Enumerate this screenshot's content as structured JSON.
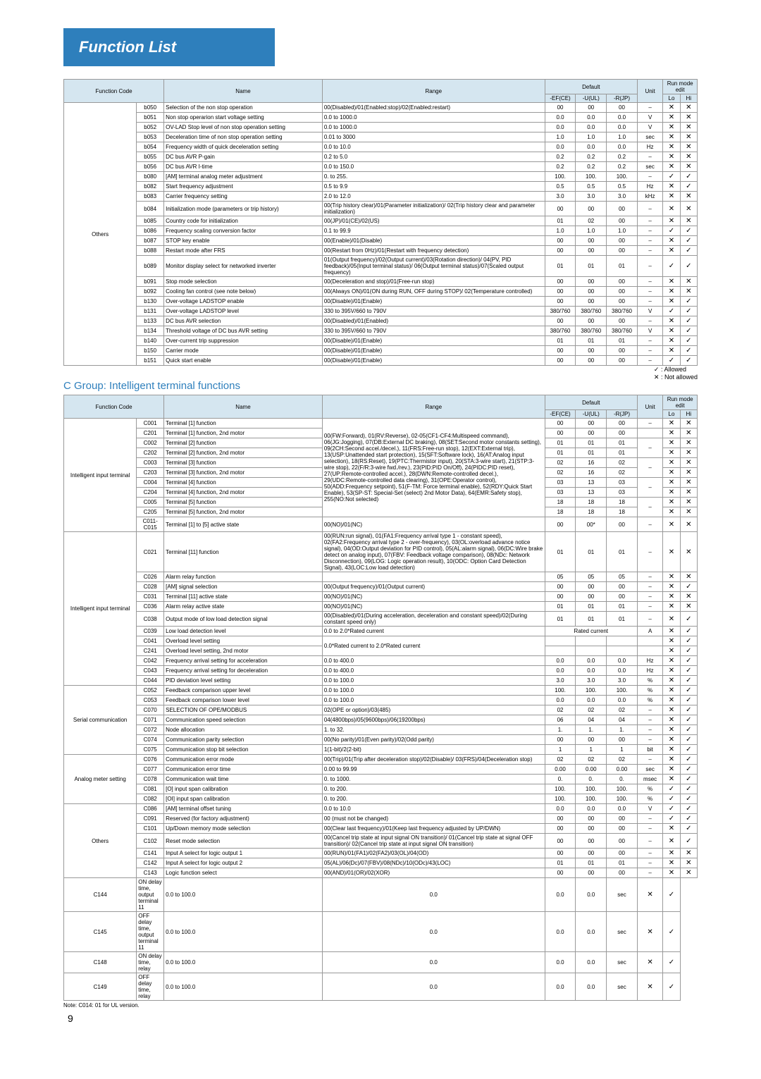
{
  "page": {
    "title": "Function List",
    "groupB_name": "Others",
    "groupC_title": "C Group: Intelligent terminal functions",
    "legend_allowed": "✓ : Allowed",
    "legend_notallowed": "✕ : Not allowed",
    "footnote": "Note: C014: 01 for UL version.",
    "pagenum": "9"
  },
  "headers": {
    "function_code": "Function Code",
    "name": "Name",
    "range": "Range",
    "default": "Default",
    "d1": "-EF(CE)",
    "d2": "-U(UL)",
    "d3": "-R(JP)",
    "unit": "Unit",
    "runmode": "Run mode edit",
    "lo": "Lo",
    "hi": "Hi"
  },
  "b_rows": [
    {
      "code": "b050",
      "name": "Selection of the non stop operation",
      "range": "00(Disabled)/01(Enabled:stop)/02(Enabled:restart)",
      "d1": "00",
      "d2": "00",
      "d3": "00",
      "unit": "–",
      "lo": "✕",
      "hi": "✕"
    },
    {
      "code": "b051",
      "name": "Non stop operarion start voltage setting",
      "range": "0.0 to 1000.0",
      "d1": "0.0",
      "d2": "0.0",
      "d3": "0.0",
      "unit": "V",
      "lo": "✕",
      "hi": "✕"
    },
    {
      "code": "b052",
      "name": "OV-LAD Stop level of non stop operation setting",
      "range": "0.0 to 1000.0",
      "d1": "0.0",
      "d2": "0.0",
      "d3": "0.0",
      "unit": "V",
      "lo": "✕",
      "hi": "✕"
    },
    {
      "code": "b053",
      "name": "Deceleration time of non stop operation setting",
      "range": "0.01 to 3000",
      "d1": "1.0",
      "d2": "1.0",
      "d3": "1.0",
      "unit": "sec",
      "lo": "✕",
      "hi": "✕"
    },
    {
      "code": "b054",
      "name": "Frequency width of quick deceleration setting",
      "range": "0.0 to 10.0",
      "d1": "0.0",
      "d2": "0.0",
      "d3": "0.0",
      "unit": "Hz",
      "lo": "✕",
      "hi": "✕"
    },
    {
      "code": "b055",
      "name": "DC bus AVR P-gain",
      "range": "0.2 to 5.0",
      "d1": "0.2",
      "d2": "0.2",
      "d3": "0.2",
      "unit": "–",
      "lo": "✕",
      "hi": "✕"
    },
    {
      "code": "b056",
      "name": "DC bus AVR I-time",
      "range": "0.0 to 150.0",
      "d1": "0.2",
      "d2": "0.2",
      "d3": "0.2",
      "unit": "sec",
      "lo": "✕",
      "hi": "✕"
    },
    {
      "code": "b080",
      "name": "[AM] terminal analog meter adjustment",
      "range": "0. to 255.",
      "d1": "100.",
      "d2": "100.",
      "d3": "100.",
      "unit": "–",
      "lo": "✓",
      "hi": "✓"
    },
    {
      "code": "b082",
      "name": "Start frequency adjustment",
      "range": "0.5 to 9.9",
      "d1": "0.5",
      "d2": "0.5",
      "d3": "0.5",
      "unit": "Hz",
      "lo": "✕",
      "hi": "✓"
    },
    {
      "code": "b083",
      "name": "Carrier frequency setting",
      "range": "2.0 to 12.0",
      "d1": "3.0",
      "d2": "3.0",
      "d3": "3.0",
      "unit": "kHz",
      "lo": "✕",
      "hi": "✕"
    },
    {
      "code": "b084",
      "name": "Initialization mode (parameters or trip history)",
      "range": "00(Trip history clear)/01(Parameter initialization)/ 02(Trip history clear and parameter initialization)",
      "d1": "00",
      "d2": "00",
      "d3": "00",
      "unit": "–",
      "lo": "✕",
      "hi": "✕"
    },
    {
      "code": "b085",
      "name": "Country code for initialization",
      "range": "00(JP)/01(CE)/02(US)",
      "d1": "01",
      "d2": "02",
      "d3": "00",
      "unit": "–",
      "lo": "✕",
      "hi": "✕"
    },
    {
      "code": "b086",
      "name": "Frequency scaling conversion factor",
      "range": "0.1 to 99.9",
      "d1": "1.0",
      "d2": "1.0",
      "d3": "1.0",
      "unit": "–",
      "lo": "✓",
      "hi": "✓"
    },
    {
      "code": "b087",
      "name": "STOP key enable",
      "range": "00(Enable)/01(Disable)",
      "d1": "00",
      "d2": "00",
      "d3": "00",
      "unit": "–",
      "lo": "✕",
      "hi": "✓"
    },
    {
      "code": "b088",
      "name": "Restart mode after FRS",
      "range": "00(Restart from 0Hz)/01(Restart with frequency detection)",
      "d1": "00",
      "d2": "00",
      "d3": "00",
      "unit": "–",
      "lo": "✕",
      "hi": "✓"
    },
    {
      "code": "b089",
      "name": "Monitor display select for networked inverter",
      "range": "01(Output frequency)/02(Output current)/03(Rotation direction)/ 04(PV, PID feedback)/05(Input terminal status)/ 06(Output terminal status)/07(Scaled output frequency)",
      "d1": "01",
      "d2": "01",
      "d3": "01",
      "unit": "–",
      "lo": "✓",
      "hi": "✓"
    },
    {
      "code": "b091",
      "name": "Stop mode selection",
      "range": "00(Deceleration and stop)/01(Free-run stop)",
      "d1": "00",
      "d2": "00",
      "d3": "00",
      "unit": "–",
      "lo": "✕",
      "hi": "✕"
    },
    {
      "code": "b092",
      "name": "Cooling fan control (see note below)",
      "range": "00(Always ON)/01(ON during RUN, OFF during STOP)/ 02(Temperature controlled)",
      "d1": "00",
      "d2": "00",
      "d3": "00",
      "unit": "–",
      "lo": "✕",
      "hi": "✕"
    },
    {
      "code": "b130",
      "name": "Over-voltage LADSTOP enable",
      "range": "00(Disable)/01(Enable)",
      "d1": "00",
      "d2": "00",
      "d3": "00",
      "unit": "–",
      "lo": "✕",
      "hi": "✓"
    },
    {
      "code": "b131",
      "name": "Over-voltage LADSTOP level",
      "range": "330 to 395V/660 to 790V",
      "d1": "380/760",
      "d2": "380/760",
      "d3": "380/760",
      "unit": "V",
      "lo": "✓",
      "hi": "✓"
    },
    {
      "code": "b133",
      "name": "DC bus AVR selection",
      "range": "00(Disabled)/01(Enabled)",
      "d1": "00",
      "d2": "00",
      "d3": "00",
      "unit": "–",
      "lo": "✕",
      "hi": "✓"
    },
    {
      "code": "b134",
      "name": "Threshold voltage of DC bus AVR setting",
      "range": "330 to 395V/660 to 790V",
      "d1": "380/760",
      "d2": "380/760",
      "d3": "380/760",
      "unit": "V",
      "lo": "✕",
      "hi": "✓"
    },
    {
      "code": "b140",
      "name": "Over-current trip suppression",
      "range": "00(Disable)/01(Enable)",
      "d1": "01",
      "d2": "01",
      "d3": "01",
      "unit": "–",
      "lo": "✕",
      "hi": "✓"
    },
    {
      "code": "b150",
      "name": "Carrier mode",
      "range": "00(Disable)/01(Enable)",
      "d1": "00",
      "d2": "00",
      "d3": "00",
      "unit": "–",
      "lo": "✕",
      "hi": "✓"
    },
    {
      "code": "b151",
      "name": "Quick start enable",
      "range": "00(Disable)/01(Enable)",
      "d1": "00",
      "d2": "00",
      "d3": "00",
      "unit": "–",
      "lo": "✓",
      "hi": "✓"
    }
  ],
  "c_groups": [
    {
      "name": "Intelligent input terminal",
      "spanstart": 0,
      "span": 11
    },
    {
      "name": "Intelligent input terminal",
      "spanstart": 11,
      "span": 12
    },
    {
      "name": "Serial communication",
      "spanstart": 23,
      "span": 7
    },
    {
      "name": "Analog meter setting",
      "spanstart": 30,
      "span": 5
    },
    {
      "name": "Others",
      "spanstart": 35,
      "span": 7
    }
  ],
  "c_rows": [
    {
      "code": "C001",
      "name": "Terminal [1] function",
      "range": "00(FW:Forward), 01(RV:Reverse), 02-05(CF1-CF4:Multispeed command), 06(JG:Jogging), 07(DB:External DC braking), 08(SET:Second motor constants setting), 09(2CH:Second accel./decel.), 11(FRS:Free-run stop), 12(EXT:External trip), 13(USP:Unattended start protection), 15(SFT:Software lock), 16(AT:Analog input selection), 18(RS:Reset), 19(PTC:Thermistor input), 20(STA:3-wire start), 21(STP:3-wire stop), 22(F/R:3-wire fwd./rev.), 23(PID:PID On/Off), 24(PIDC:PID reset), 27(UP:Remote-controlled accel.), 28(DWN:Remote-controlled decel.), 29(UDC:Remote-controlled data clearing), 31(OPE:Operator control), 50(ADD:Frequency setpoint), 51(F-TM: Force terminal enable), 52(RDY:Quick Start Enable), 53(SP-ST: Special-Set (select) 2nd Motor Data), 64(EMR:Safety stop), 255(NO:Not selected)",
      "d1": "00",
      "d2": "00",
      "d3": "00",
      "unit": "–",
      "lo": "✕",
      "hi": "✕",
      "rangerowspan": 10
    },
    {
      "code": "C201",
      "name": "Terminal [1] function, 2nd motor",
      "range": "",
      "d1": "00",
      "d2": "00",
      "d3": "00",
      "unit": "",
      "lo": "✕",
      "hi": "✕"
    },
    {
      "code": "C002",
      "name": "Terminal [2] function",
      "range": "",
      "d1": "01",
      "d2": "01",
      "d3": "01",
      "unit": "–",
      "lo": "✕",
      "hi": "✕",
      "unitspan": 2
    },
    {
      "code": "C202",
      "name": "Terminal [2] function, 2nd motor",
      "range": "",
      "d1": "01",
      "d2": "01",
      "d3": "01",
      "unit": "",
      "lo": "✕",
      "hi": "✕"
    },
    {
      "code": "C003",
      "name": "Terminal [3] function",
      "range": "",
      "d1": "02",
      "d2": "16",
      "d3": "02",
      "unit": "–",
      "lo": "✕",
      "hi": "✕",
      "unitspan": 2
    },
    {
      "code": "C203",
      "name": "Terminal [3] function, 2nd motor",
      "range": "",
      "d1": "02",
      "d2": "16",
      "d3": "02",
      "unit": "",
      "lo": "✕",
      "hi": "✕"
    },
    {
      "code": "C004",
      "name": "Terminal [4] function",
      "range": "",
      "d1": "03",
      "d2": "13",
      "d3": "03",
      "unit": "–",
      "lo": "✕",
      "hi": "✕",
      "unitspan": 2
    },
    {
      "code": "C204",
      "name": "Terminal [4] function, 2nd motor",
      "range": "",
      "d1": "03",
      "d2": "13",
      "d3": "03",
      "unit": "",
      "lo": "✕",
      "hi": "✕"
    },
    {
      "code": "C005",
      "name": "Terminal [5] function",
      "range": "",
      "d1": "18",
      "d2": "18",
      "d3": "18",
      "unit": "–",
      "lo": "✕",
      "hi": "✕",
      "unitspan": 2
    },
    {
      "code": "C205",
      "name": "Terminal [5] function, 2nd motor",
      "range": "",
      "d1": "18",
      "d2": "18",
      "d3": "18",
      "unit": "",
      "lo": "✕",
      "hi": "✕"
    },
    {
      "code": "C011-C015",
      "name": "Terminal [1] to [5] active state",
      "range": "00(NO)/01(NC)",
      "d1": "00",
      "d2": "00*",
      "d3": "00",
      "unit": "–",
      "lo": "✕",
      "hi": "✕"
    },
    {
      "code": "C021",
      "name": "Terminal [11] function",
      "range": "00(RUN:run signal), 01(FA1:Frequency arrival type 1 - constant speed), 02(FA2:Frequency arrival type 2 - over-frequency), 03(OL:overload advance notice signal), 04(OD:Output deviation for PID control), 05(AL:alarm signal), 06(DC:Wire brake detect on analog input), 07(FBV: Feedback voltage comparison), 08(NDc: Network Disconnection), 09(LOG: Logic operation result), 10(ODC: Option Card Detection Signal), 43(LOC:Low load detection)",
      "d1": "01",
      "d2": "01",
      "d3": "01",
      "unit": "–",
      "lo": "✕",
      "hi": "✕"
    },
    {
      "code": "C026",
      "name": "Alarm relay function",
      "range": "",
      "d1": "05",
      "d2": "05",
      "d3": "05",
      "unit": "–",
      "lo": "✕",
      "hi": "✕"
    },
    {
      "code": "C028",
      "name": "[AM] signal selection",
      "range": "00(Output frequency)/01(Output current)",
      "d1": "00",
      "d2": "00",
      "d3": "00",
      "unit": "–",
      "lo": "✕",
      "hi": "✓"
    },
    {
      "code": "C031",
      "name": "Terminal [11] active state",
      "range": "00(NO)/01(NC)",
      "d1": "00",
      "d2": "00",
      "d3": "00",
      "unit": "–",
      "lo": "✕",
      "hi": "✕"
    },
    {
      "code": "C036",
      "name": "Alarm relay active state",
      "range": "00(NO)/01(NC)",
      "d1": "01",
      "d2": "01",
      "d3": "01",
      "unit": "–",
      "lo": "✕",
      "hi": "✕"
    },
    {
      "code": "C038",
      "name": "Output mode of low load detection signal",
      "range": "00(Disabled)/01(During acceleration, deceleration and constant speed)/02(During constant speed only)",
      "d1": "01",
      "d2": "01",
      "d3": "01",
      "unit": "–",
      "lo": "✕",
      "hi": "✓"
    },
    {
      "code": "C039",
      "name": "Low load detection level",
      "range": "0.0 to 2.0*Rated current",
      "d1": "",
      "d2": "",
      "d3": "",
      "unit": "",
      "lo": "✕",
      "hi": "✓",
      "d_merge": "Rated current",
      "d_unit": "A"
    },
    {
      "code": "C041",
      "name": "Overload level setting",
      "range": "0.0*Rated current to 2.0*Rated current",
      "d1": "",
      "d2": "",
      "d3": "",
      "unit": "",
      "lo": "✕",
      "hi": "✓",
      "rangerowspan": 2,
      "d_merge_rows": 2
    },
    {
      "code": "C241",
      "name": "Overload level setting, 2nd motor",
      "range": "",
      "d1": "",
      "d2": "",
      "d3": "",
      "unit": "",
      "lo": "✕",
      "hi": "✓"
    },
    {
      "code": "C042",
      "name": "Frequency arrival setting for acceleration",
      "range": "0.0 to 400.0",
      "d1": "0.0",
      "d2": "0.0",
      "d3": "0.0",
      "unit": "Hz",
      "lo": "✕",
      "hi": "✓"
    },
    {
      "code": "C043",
      "name": "Frequency arrival setting for deceleration",
      "range": "0.0 to 400.0",
      "d1": "0.0",
      "d2": "0.0",
      "d3": "0.0",
      "unit": "Hz",
      "lo": "✕",
      "hi": "✓"
    },
    {
      "code": "C044",
      "name": "PID deviation level setting",
      "range": "0.0 to 100.0",
      "d1": "3.0",
      "d2": "3.0",
      "d3": "3.0",
      "unit": "%",
      "lo": "✕",
      "hi": "✓"
    },
    {
      "code": "C052",
      "name": "Feedback comparison upper level",
      "range": "0.0 to 100.0",
      "d1": "100.",
      "d2": "100.",
      "d3": "100.",
      "unit": "%",
      "lo": "✕",
      "hi": "✓"
    },
    {
      "code": "C053",
      "name": "Feedback comparison lower level",
      "range": "0.0 to 100.0",
      "d1": "0.0",
      "d2": "0.0",
      "d3": "0.0",
      "unit": "%",
      "lo": "✕",
      "hi": "✓"
    },
    {
      "code": "C070",
      "name": "SELECTION OF OPE/MODBUS",
      "range": "02(OPE or option)/03(485)",
      "d1": "02",
      "d2": "02",
      "d3": "02",
      "unit": "–",
      "lo": "✕",
      "hi": "✓"
    },
    {
      "code": "C071",
      "name": "Communication speed selection",
      "range": "04(4800bps)/05(9600bps)/06(19200bps)",
      "d1": "06",
      "d2": "04",
      "d3": "04",
      "unit": "–",
      "lo": "✕",
      "hi": "✓"
    },
    {
      "code": "C072",
      "name": "Node allocation",
      "range": "1. to 32.",
      "d1": "1.",
      "d2": "1.",
      "d3": "1.",
      "unit": "–",
      "lo": "✕",
      "hi": "✓"
    },
    {
      "code": "C074",
      "name": "Communication parity selection",
      "range": "00(No parity)/01(Even parity)/02(Odd parity)",
      "d1": "00",
      "d2": "00",
      "d3": "00",
      "unit": "–",
      "lo": "✕",
      "hi": "✓"
    },
    {
      "code": "C075",
      "name": "Communication stop bit selection",
      "range": "1(1-bit)/2(2-bit)",
      "d1": "1",
      "d2": "1",
      "d3": "1",
      "unit": "bit",
      "lo": "✕",
      "hi": "✓"
    },
    {
      "code": "C076",
      "name": "Communication error mode",
      "range": "00(Trip)/01(Trip after deceleration stop)/02(Disable)/ 03(FRS)/04(Deceleration stop)",
      "d1": "02",
      "d2": "02",
      "d3": "02",
      "unit": "–",
      "lo": "✕",
      "hi": "✓"
    },
    {
      "code": "C077",
      "name": "Communication error time",
      "range": "0.00 to 99.99",
      "d1": "0.00",
      "d2": "0.00",
      "d3": "0.00",
      "unit": "sec",
      "lo": "✕",
      "hi": "✓"
    },
    {
      "code": "C078",
      "name": "Communication wait time",
      "range": "0. to 1000.",
      "d1": "0.",
      "d2": "0.",
      "d3": "0.",
      "unit": "msec",
      "lo": "✕",
      "hi": "✓"
    },
    {
      "code": "C081",
      "name": "[O] input span calibration",
      "range": "0. to 200.",
      "d1": "100.",
      "d2": "100.",
      "d3": "100.",
      "unit": "%",
      "lo": "✓",
      "hi": "✓"
    },
    {
      "code": "C082",
      "name": "[OI] input span calibration",
      "range": "0. to 200.",
      "d1": "100.",
      "d2": "100.",
      "d3": "100.",
      "unit": "%",
      "lo": "✓",
      "hi": "✓"
    },
    {
      "code": "C086",
      "name": "[AM] terminal offset tuning",
      "range": "0.0 to 10.0",
      "d1": "0.0",
      "d2": "0.0",
      "d3": "0.0",
      "unit": "V",
      "lo": "✓",
      "hi": "✓"
    },
    {
      "code": "C091",
      "name": "Reserved (for factory adjustment)",
      "range": "00 (must not be changed)",
      "d1": "00",
      "d2": "00",
      "d3": "00",
      "unit": "–",
      "lo": "✓",
      "hi": "✓"
    },
    {
      "code": "C101",
      "name": "Up/Down memory mode selection",
      "range": "00(Clear last frequency)/01(Keep last frequency adjusted by UP/DWN)",
      "d1": "00",
      "d2": "00",
      "d3": "00",
      "unit": "–",
      "lo": "✕",
      "hi": "✓"
    },
    {
      "code": "C102",
      "name": "Reset mode selection",
      "range": "00(Cancel trip state at input signal ON transition)/ 01(Cancel trip state at signal OFF transition)/ 02(Cancel trip state at input signal ON transition)",
      "d1": "00",
      "d2": "00",
      "d3": "00",
      "unit": "–",
      "lo": "✕",
      "hi": "✓"
    },
    {
      "code": "C141",
      "name": "Input A select for logic output 1",
      "range": "00(RUN)/01(FA1)/02(FA2)/03(OL)/04(OD)",
      "d1": "00",
      "d2": "00",
      "d3": "00",
      "unit": "–",
      "lo": "✕",
      "hi": "✕"
    },
    {
      "code": "C142",
      "name": "Input A select for logic output 2",
      "range": "05(AL)/06(Dc)/07(FBV)/08(NDc)/10(ODc)/43(LOC)",
      "d1": "01",
      "d2": "01",
      "d3": "01",
      "unit": "–",
      "lo": "✕",
      "hi": "✕"
    },
    {
      "code": "C143",
      "name": "Logic function select",
      "range": "00(AND)/01(OR)/02(XOR)",
      "d1": "00",
      "d2": "00",
      "d3": "00",
      "unit": "–",
      "lo": "✕",
      "hi": "✕"
    },
    {
      "code": "C144",
      "name": "ON delay time, output terminal 11",
      "range": "0.0 to 100.0",
      "d1": "0.0",
      "d2": "0.0",
      "d3": "0.0",
      "unit": "sec",
      "lo": "✕",
      "hi": "✓"
    },
    {
      "code": "C145",
      "name": "OFF delay time, output terminal 11",
      "range": "0.0 to 100.0",
      "d1": "0.0",
      "d2": "0.0",
      "d3": "0.0",
      "unit": "sec",
      "lo": "✕",
      "hi": "✓"
    },
    {
      "code": "C148",
      "name": "ON delay time, relay",
      "range": "0.0 to 100.0",
      "d1": "0.0",
      "d2": "0.0",
      "d3": "0.0",
      "unit": "sec",
      "lo": "✕",
      "hi": "✓"
    },
    {
      "code": "C149",
      "name": "OFF delay time, relay",
      "range": "0.0 to 100.0",
      "d1": "0.0",
      "d2": "0.0",
      "d3": "0.0",
      "unit": "sec",
      "lo": "✕",
      "hi": "✓"
    }
  ]
}
